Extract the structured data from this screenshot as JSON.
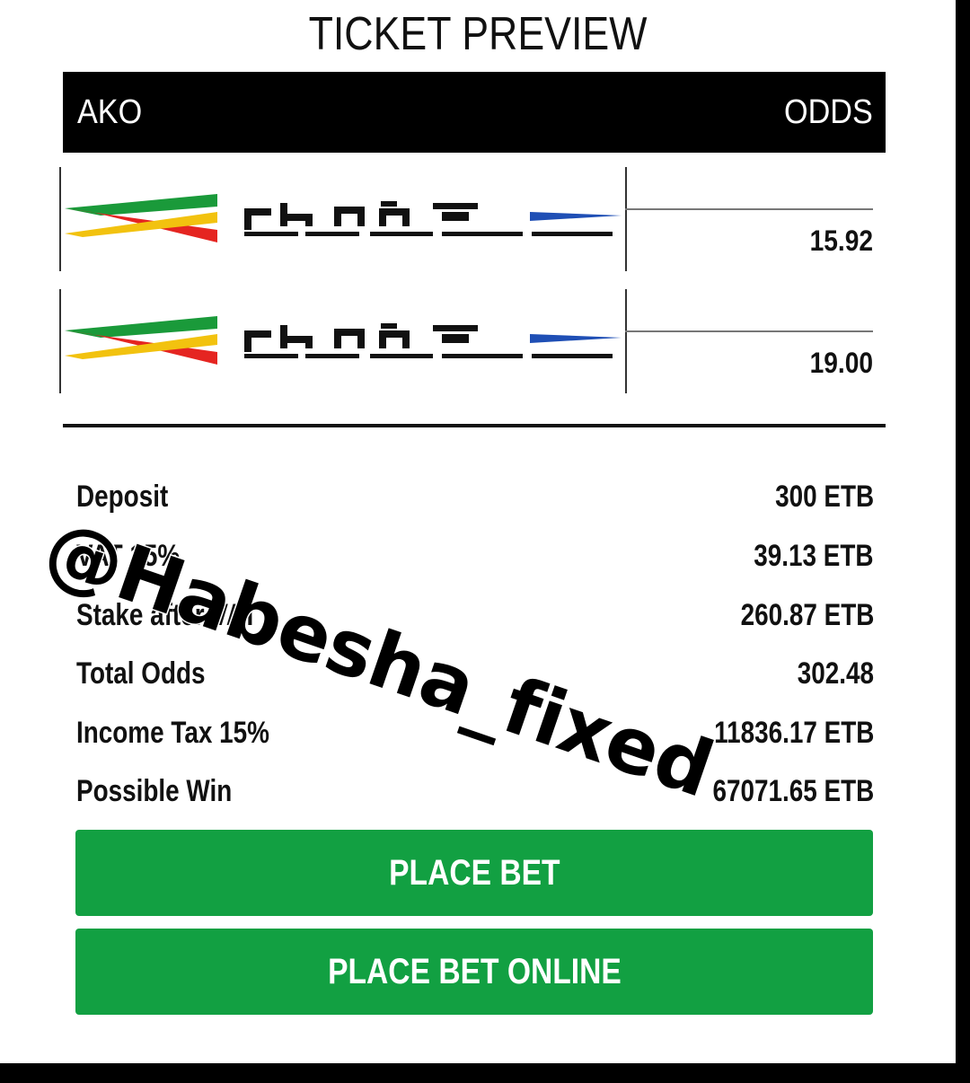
{
  "page": {
    "title": "TICKET PREVIEW"
  },
  "table": {
    "header_left": "AKO",
    "header_right": "ODDS",
    "rows": [
      {
        "logo": "brand-logo",
        "odds": "15.92"
      },
      {
        "logo": "brand-logo",
        "odds": "19.00"
      }
    ]
  },
  "summary": [
    {
      "label": "Deposit",
      "value": "300 ETB"
    },
    {
      "label": "VAT 15%",
      "value": "39.13 ETB"
    },
    {
      "label": "Stake after VAT",
      "value": "260.87 ETB"
    },
    {
      "label": "Total Odds",
      "value": "302.48"
    },
    {
      "label": "Income Tax 15%",
      "value": "11836.17 ETB"
    },
    {
      "label": "Possible Win",
      "value": "67071.65 ETB"
    }
  ],
  "buttons": {
    "place_bet": "PLACE BET",
    "place_bet_online": "PLACE BET ONLINE"
  },
  "watermark": "@Habesha_fixed",
  "colors": {
    "button_green": "#12a042",
    "header_black": "#000000"
  }
}
